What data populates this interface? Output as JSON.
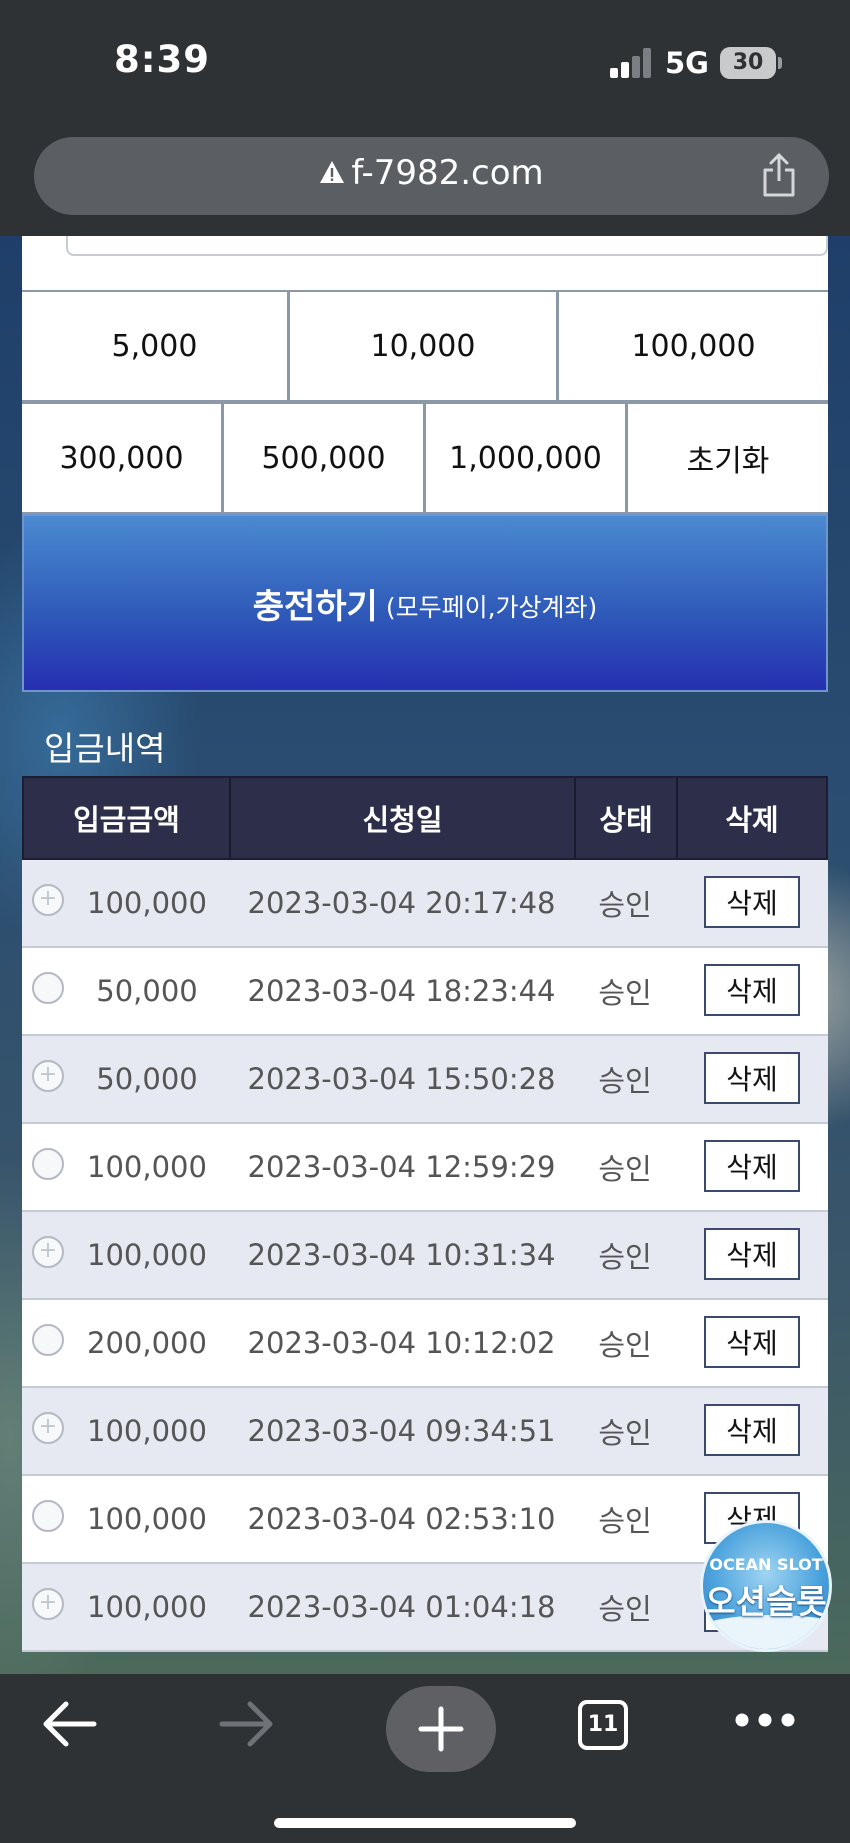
{
  "status_bar": {
    "time": "8:39",
    "network": "5G",
    "battery": "30"
  },
  "browser": {
    "url": "f-7982.com",
    "open_tabs": "11"
  },
  "amount_buttons": {
    "row1": [
      "5,000",
      "10,000",
      "100,000"
    ],
    "row2": [
      "300,000",
      "500,000",
      "1,000,000",
      "초기화"
    ]
  },
  "charge_button": {
    "label": "충전하기",
    "sub_label": "(모두페이,가상계좌)"
  },
  "history": {
    "title": "입금내역",
    "columns": [
      "입금금액",
      "신청일",
      "상태",
      "삭제"
    ],
    "rows": [
      {
        "amount": "100,000",
        "date": "2023-03-04 20:17:48",
        "status": "승인",
        "action": "삭제"
      },
      {
        "amount": "50,000",
        "date": "2023-03-04 18:23:44",
        "status": "승인",
        "action": "삭제"
      },
      {
        "amount": "50,000",
        "date": "2023-03-04 15:50:28",
        "status": "승인",
        "action": "삭제"
      },
      {
        "amount": "100,000",
        "date": "2023-03-04 12:59:29",
        "status": "승인",
        "action": "삭제"
      },
      {
        "amount": "100,000",
        "date": "2023-03-04 10:31:34",
        "status": "승인",
        "action": "삭제"
      },
      {
        "amount": "200,000",
        "date": "2023-03-04 10:12:02",
        "status": "승인",
        "action": "삭제"
      },
      {
        "amount": "100,000",
        "date": "2023-03-04 09:34:51",
        "status": "승인",
        "action": "삭제"
      },
      {
        "amount": "100,000",
        "date": "2023-03-04 02:53:10",
        "status": "승인",
        "action": "삭제"
      },
      {
        "amount": "100,000",
        "date": "2023-03-04 01:04:18",
        "status": "승인",
        "action": "삭제"
      }
    ]
  },
  "overlay_logo": {
    "text_en": "OCEAN SLOT",
    "text_kr": "오션슬롯"
  },
  "colors": {
    "chrome_bg": "#2f3235",
    "table_header": "#2d2e4a",
    "charge_button_top": "#4b8ad1",
    "charge_button_bottom": "#262fb2"
  },
  "icons": {
    "back": "arrow-left-icon",
    "forward": "arrow-right-icon",
    "new_tab": "plus-icon",
    "tabs": "tabs-icon",
    "menu": "more-dots-icon",
    "share": "share-icon",
    "warning": "warning-icon"
  }
}
